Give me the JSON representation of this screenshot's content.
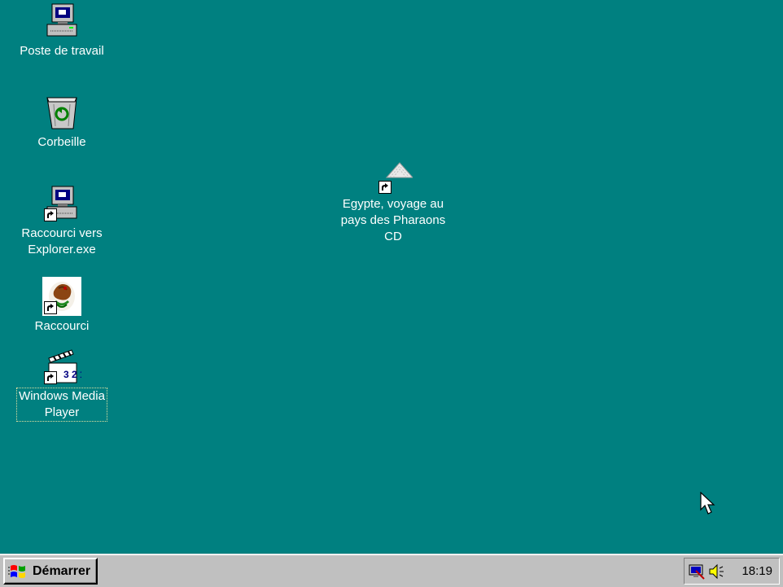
{
  "desktop": {
    "background": "#008080",
    "icons": [
      {
        "label": "Poste de travail",
        "icon": "my-computer-icon",
        "shortcut": false
      },
      {
        "label": "Corbeille",
        "icon": "recycle-bin-icon",
        "shortcut": false
      },
      {
        "label": "Raccourci vers\nExplorer.exe",
        "icon": "computer-shortcut-icon",
        "shortcut": true
      },
      {
        "label": "Raccourci",
        "icon": "mexico-flag-shortcut-icon",
        "shortcut": true
      },
      {
        "label": "Windows Media\nPlayer",
        "icon": "media-player-icon",
        "shortcut": true,
        "selected": true
      },
      {
        "label": "Egypte, voyage au\npays des Pharaons\nCD",
        "icon": "egypt-cd-shortcut-icon",
        "shortcut": true
      }
    ]
  },
  "taskbar": {
    "start_label": "Démarrer",
    "clock": "18:19",
    "tray_icons": [
      "display-tray-icon",
      "volume-icon"
    ]
  }
}
